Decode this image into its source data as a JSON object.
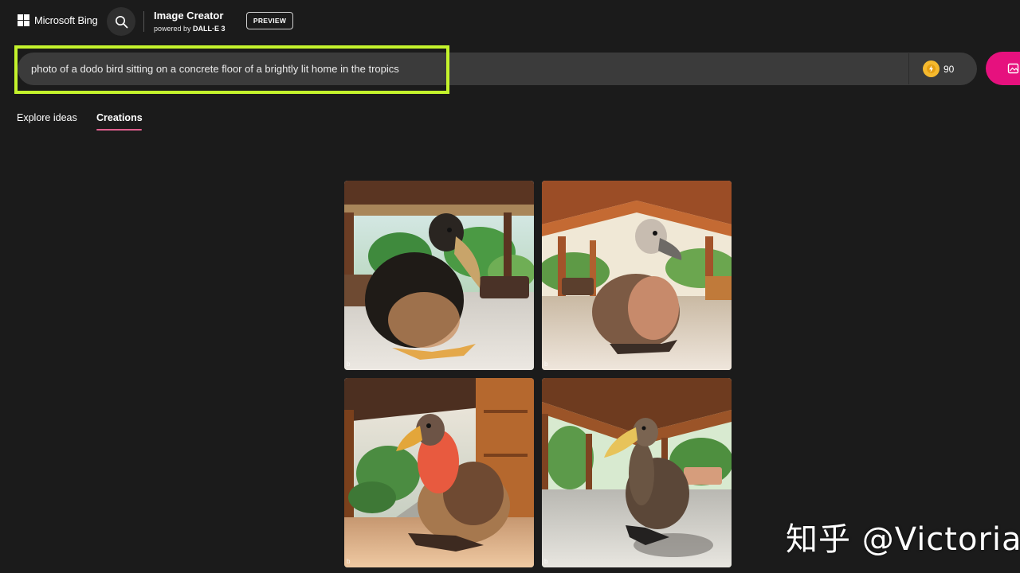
{
  "header": {
    "brand": "Microsoft Bing",
    "title": "Image Creator",
    "subtitle_prefix": "powered by",
    "subtitle_engine": "DALL·E 3",
    "badge": "PREVIEW"
  },
  "prompt": {
    "value": "photo of a dodo bird sitting on a concrete floor of a brightly lit home in the tropics",
    "highlight_color": "#c4f32c"
  },
  "boosts": {
    "count": "90",
    "icon": "lightning-coin-icon"
  },
  "create_button": {
    "color": "#e6117e",
    "icon": "create-image-icon"
  },
  "tabs": [
    {
      "label": "Explore ideas",
      "active": false
    },
    {
      "label": "Creations",
      "active": true
    }
  ],
  "images": [
    {
      "mark": "b"
    },
    {
      "mark": "b"
    },
    {
      "mark": "b"
    },
    {
      "mark": "b"
    }
  ],
  "watermark": "知乎 @Victoria"
}
